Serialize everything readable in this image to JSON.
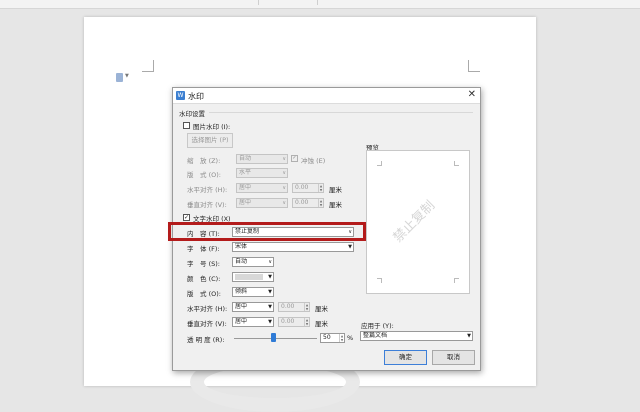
{
  "dialog": {
    "title": "水印",
    "icon": "watermark-app-icon",
    "settings_group_label": "水印设置",
    "preview_label": "预览",
    "preview_watermark_text": "禁止复制"
  },
  "picture": {
    "checkbox_label": "图片水印 (I):",
    "checked": false,
    "select_button": "选择图片 (P)",
    "scale_label": "缩　放 (Z):",
    "scale_value": "自动",
    "washout_label": "冲蚀 (E)",
    "washout_checked": true,
    "layout_label": "版　式 (O):",
    "layout_value": "水平",
    "halign_label": "水平对齐 (H):",
    "halign_value": "居中",
    "halign_offset": "0.00",
    "valign_label": "垂直对齐 (V):",
    "valign_value": "居中",
    "valign_offset": "0.00",
    "unit": "厘米"
  },
  "text": {
    "checkbox_label": "文字水印 (X)",
    "checked": true,
    "content_label": "内　容 (T):",
    "content_value": "禁止复制",
    "font_label": "字　体 (F):",
    "font_value": "宋体",
    "size_label": "字　号 (S):",
    "size_value": "自动",
    "color_label": "颜　色 (C):",
    "layout_label": "版　式 (O):",
    "layout_value": "倾斜",
    "halign_label": "水平对齐 (H):",
    "halign_value": "居中",
    "halign_offset": "0.00",
    "valign_label": "垂直对齐 (V):",
    "valign_value": "居中",
    "valign_offset": "0.00",
    "unit": "厘米",
    "transparency_label": "透 明 度 (R):",
    "transparency_value": "50",
    "transparency_unit": "%",
    "transparency_level": 0.5
  },
  "apply": {
    "label": "应用于 (Y):",
    "value": "整篇文档"
  },
  "buttons": {
    "ok": "确定",
    "cancel": "取消"
  },
  "colors": {
    "highlight_border": "#b31b1b",
    "accent": "#3b7fd1"
  }
}
